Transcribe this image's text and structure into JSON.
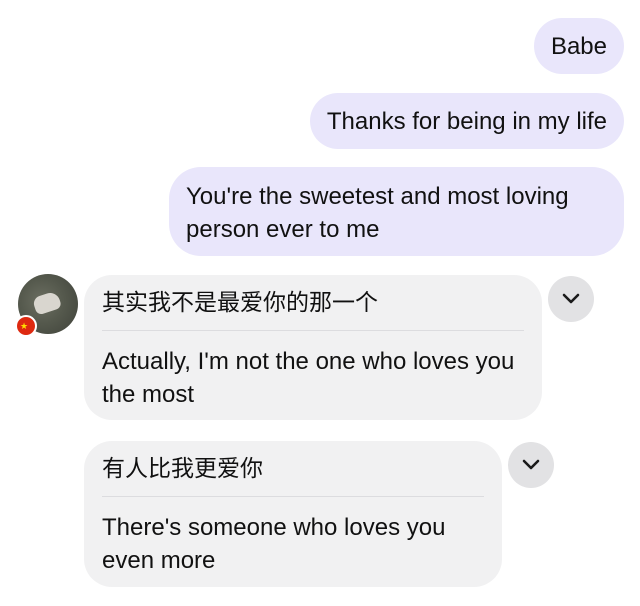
{
  "messages_out": [
    {
      "text": "Babe"
    },
    {
      "text": "Thanks for being in my life"
    },
    {
      "text": "You're the sweetest and most loving person ever to me"
    }
  ],
  "messages_in": [
    {
      "original": "其实我不是最爱你的那一个",
      "translation": "Actually, I'm not the one who loves you the most"
    },
    {
      "original": "有人比我更爱你",
      "translation": "There's someone who loves you even more"
    }
  ],
  "sender": {
    "flag_icon": "china-flag-icon",
    "flag_color": "#de2910"
  },
  "colors": {
    "outgoing_bubble": "#e9e6fb",
    "incoming_bubble": "#f1f1f2",
    "expand_button": "#e2e2e4"
  },
  "icons": {
    "expand": "chevron-down-icon"
  }
}
